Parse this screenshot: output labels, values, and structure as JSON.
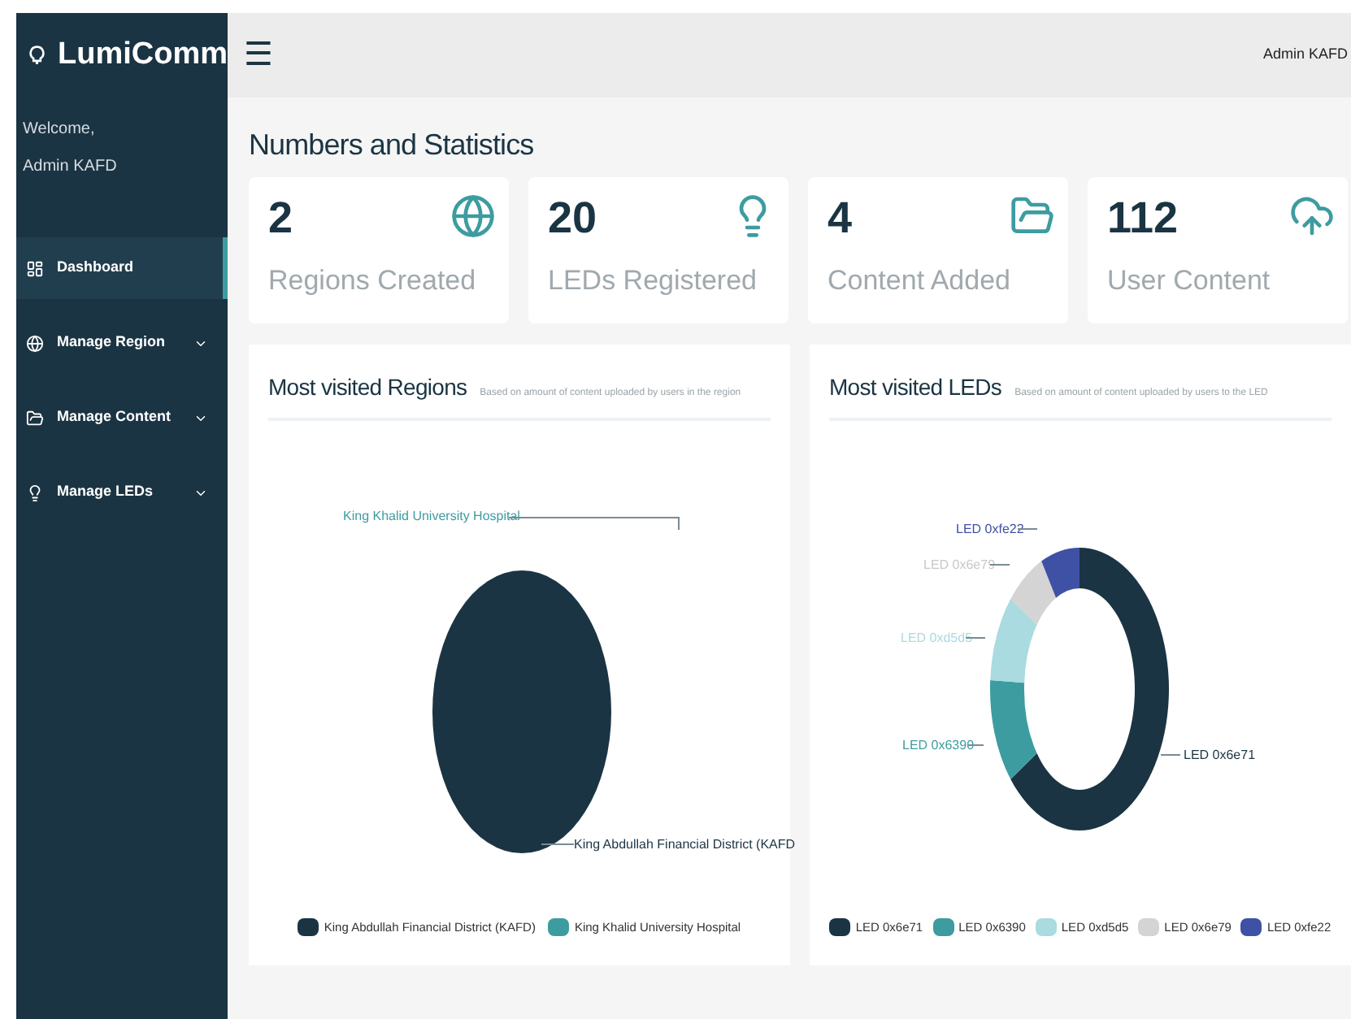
{
  "brand": "LumiComm",
  "welcome": {
    "greeting": "Welcome,",
    "user": "Admin KAFD"
  },
  "sidebar": {
    "items": [
      {
        "label": "Dashboard",
        "kind": "link",
        "selected": true
      },
      {
        "label": "Manage Region",
        "kind": "menu",
        "selected": false
      },
      {
        "label": "Manage Content",
        "kind": "menu",
        "selected": false
      },
      {
        "label": "Manage LEDs",
        "kind": "menu",
        "selected": false
      }
    ]
  },
  "topbar": {
    "menu": "☰",
    "user": "Admin KAFD"
  },
  "heading": "Numbers and Statistics",
  "stats": [
    {
      "value": "2",
      "label": "Regions Created"
    },
    {
      "value": "20",
      "label": "LEDs Registered"
    },
    {
      "value": "4",
      "label": "Content Added"
    },
    {
      "value": "112",
      "label": "User Content"
    }
  ],
  "charts": [
    {
      "kind": "pie",
      "title": "Most visited Regions",
      "subtitle": "Based on amount of content uploaded by users in the region",
      "callouts": [
        {
          "label": "King Khalid University Hospital",
          "color": "#3d9ca0"
        },
        {
          "label": "King Abdullah Financial District (KAFD",
          "color": "#1b3443"
        }
      ],
      "legend": [
        {
          "label": "King Abdullah Financial District (KAFD)",
          "color": "#1b3443"
        },
        {
          "label": "King Khalid University Hospital",
          "color": "#3d9ca0"
        }
      ]
    },
    {
      "kind": "donut",
      "title": "Most visited LEDs",
      "subtitle": "Based on amount of content uploaded by users to the LED",
      "callouts": [
        {
          "label": "LED 0xfe22",
          "color": "#3f51a5"
        },
        {
          "label": "LED 0x6e79",
          "color": "#d4d4d4"
        },
        {
          "label": "LED 0xd5d5",
          "color": "#a9dbe0"
        },
        {
          "label": "LED 0x6390",
          "color": "#3d9ca0"
        },
        {
          "label": "LED 0x6e71",
          "color": "#1b3443"
        }
      ],
      "legend": [
        {
          "label": "LED 0x6e71",
          "color": "#1b3443"
        },
        {
          "label": "LED 0x6390",
          "color": "#3d9ca0"
        },
        {
          "label": "LED 0xd5d5",
          "color": "#a9dbe0"
        },
        {
          "label": "LED 0x6e79",
          "color": "#d4d4d4"
        },
        {
          "label": "LED 0xfe22",
          "color": "#3f51a5"
        }
      ]
    }
  ]
}
